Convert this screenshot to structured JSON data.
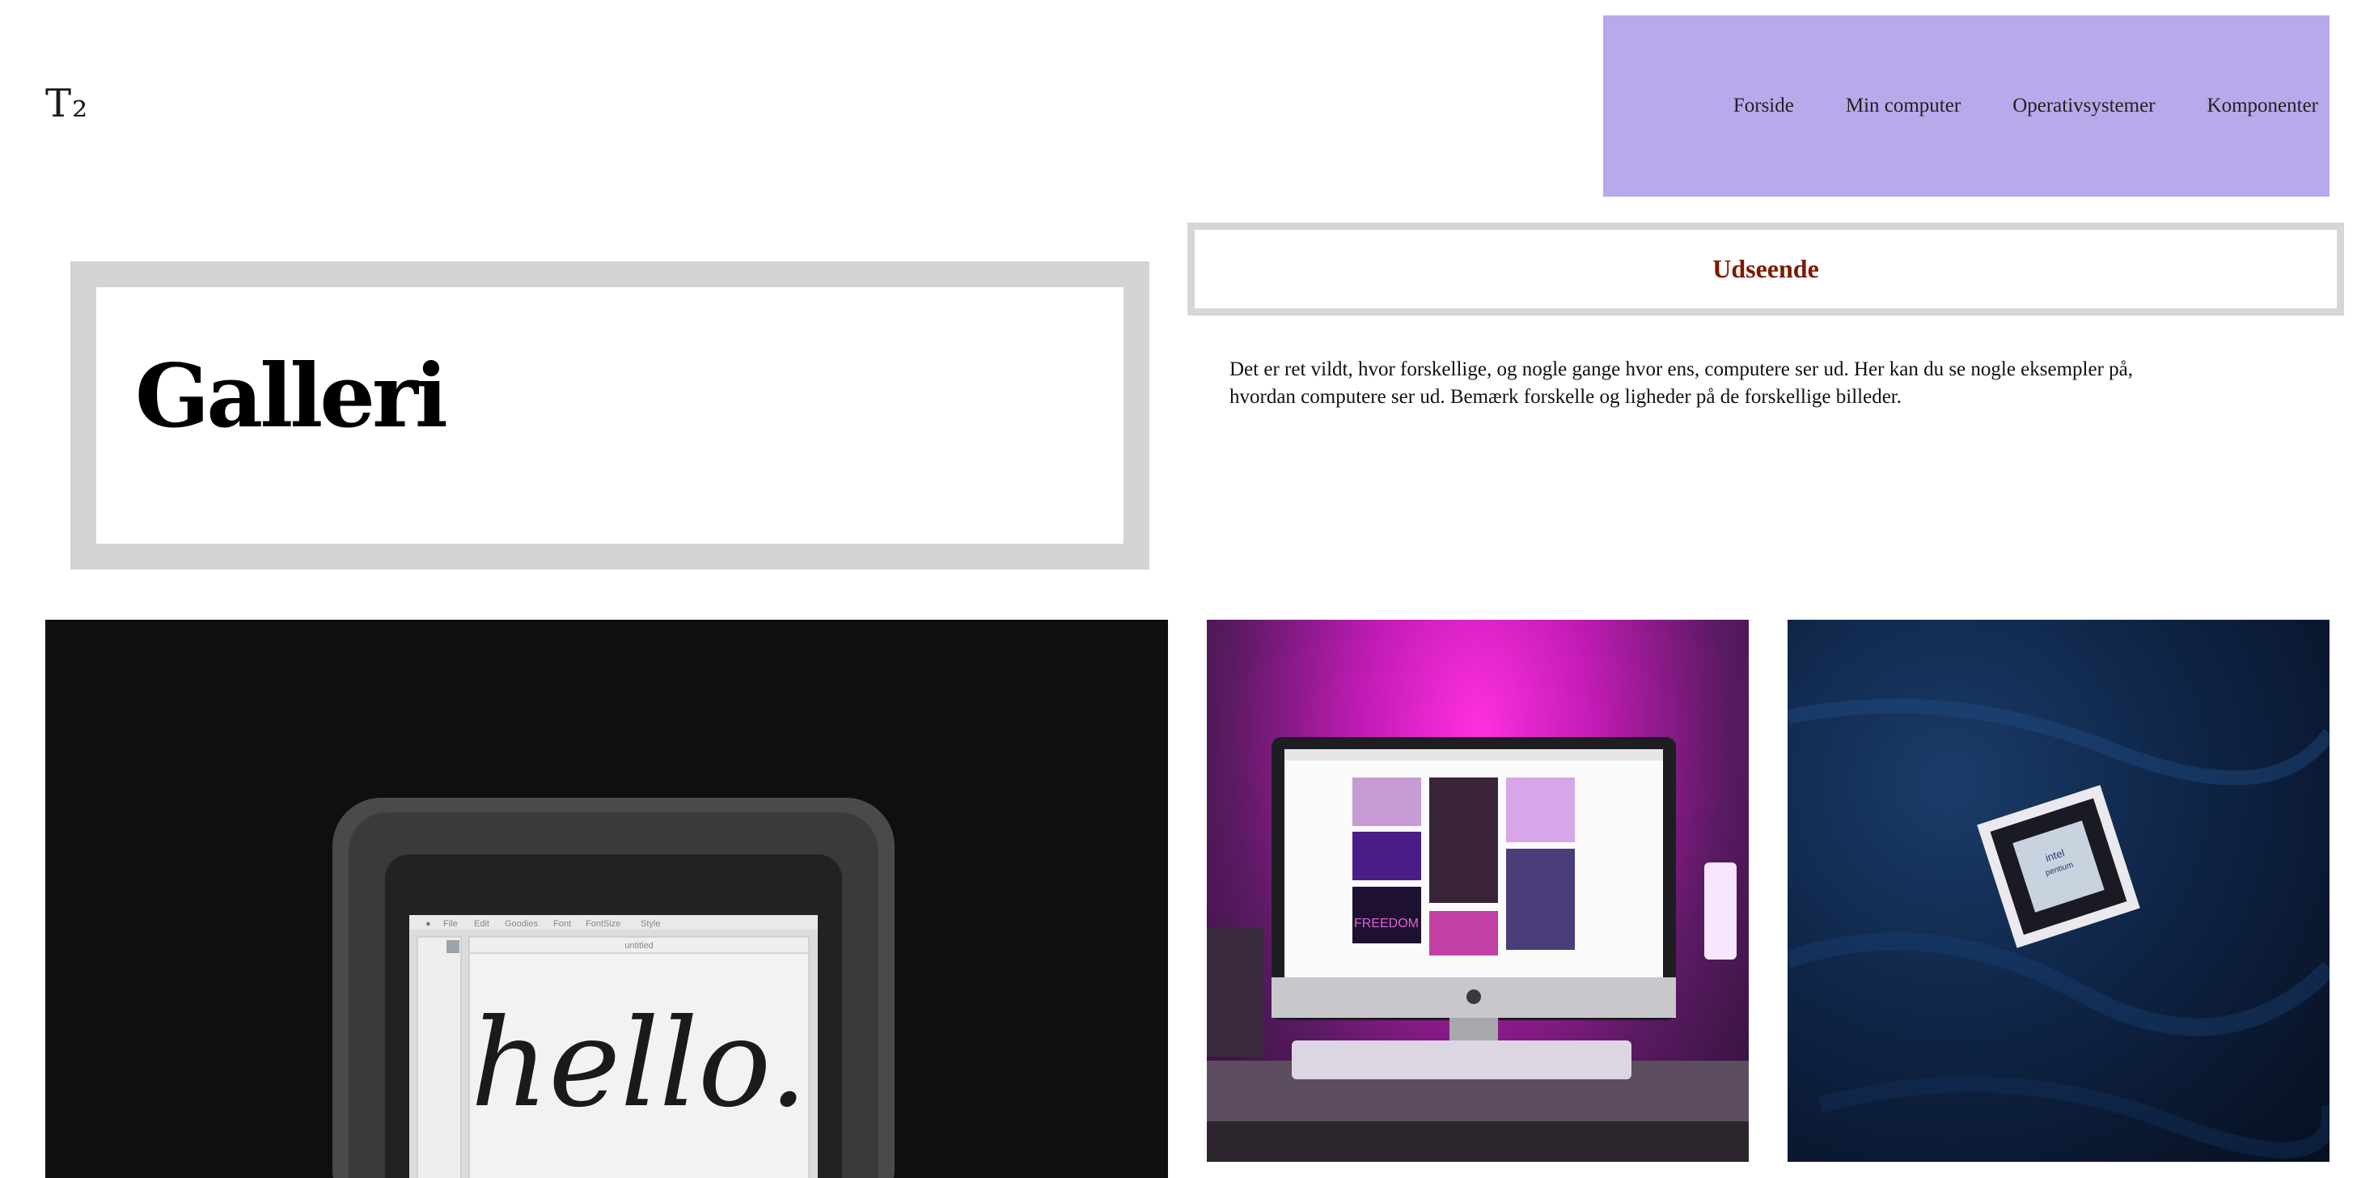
{
  "header": {
    "logo": "T₂",
    "nav": [
      {
        "label": "Forside"
      },
      {
        "label": "Min computer"
      },
      {
        "label": "Operativsystemer"
      },
      {
        "label": "Komponenter"
      }
    ],
    "nav_background": "#b7a9ea"
  },
  "gallery": {
    "title": "Galleri"
  },
  "section": {
    "title": "Udseende",
    "title_color": "#7a1b00",
    "intro_line1": "Det er ret vildt, hvor forskellige, og nogle gange hvor ens, computere ser ud. Her kan du se nogle eksempler på,",
    "intro_line2": "hvordan computere ser ud. Bemærk forskelle og ligheder på de forskellige billeder."
  },
  "images": {
    "mac": {
      "screen_text": "hello.",
      "menu_items": [
        "File",
        "Edit",
        "Goodies",
        "Font",
        "FontSize",
        "Style"
      ],
      "window_title": "untitled"
    },
    "desk": {
      "poster_text": "FREEDOM"
    },
    "chip": {
      "brand": "intel",
      "model": "pentium"
    }
  }
}
